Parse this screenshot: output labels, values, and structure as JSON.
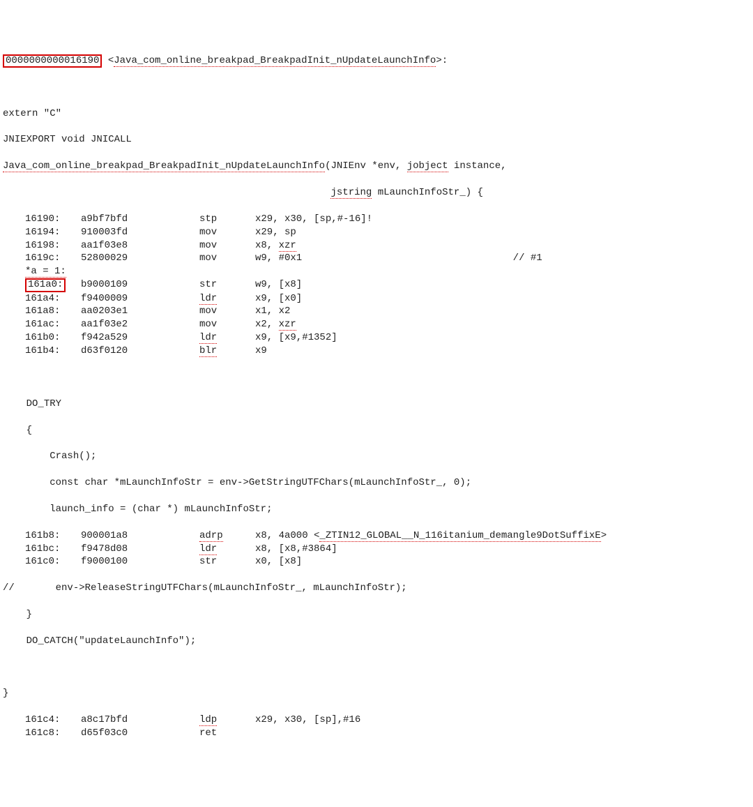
{
  "header": {
    "offset": "0000000000016190",
    "symbol": "Java_com_online_breakpad_BreakpadInit_nUpdateLaunchInfo"
  },
  "decl": {
    "externC": "extern \"C\"",
    "jniexport": "JNIEXPORT void JNICALL",
    "fn": "Java_com_online_breakpad_BreakpadInit_nUpdateLaunchInfo",
    "params1a": "(JNIEnv *env, ",
    "params1b": "jobject",
    "params1c": " instance,",
    "params2a": "jstring",
    "params2b": " mLaunchInfoStr_) {"
  },
  "src": {
    "aeq1": "*a = 1:",
    "do_try": "DO_TRY",
    "lbrace": "{",
    "crash": "    Crash();",
    "assign1": "    const char *mLaunchInfoStr = env->GetStringUTFChars(mLaunchInfoStr_, 0);",
    "assign2": "    launch_info = (char *) mLaunchInfoStr;",
    "release_pre": "//       env->ReleaseStringUTFChars(mLaunchInfoStr_, mLaunchInfoStr);",
    "rbrace": "}",
    "do_catch": "DO_CATCH(\"updateLaunchInfo\");",
    "fn_rbrace": "}"
  },
  "asm": [
    {
      "addr": "16190:",
      "op": "a9bf7bfd",
      "m": "stp",
      "args": "x29, x30, [sp,#-16]!"
    },
    {
      "addr": "16194:",
      "op": "910003fd",
      "m": "mov",
      "args": "x29, sp"
    },
    {
      "addr": "16198:",
      "op": "aa1f03e8",
      "m": "mov",
      "args_pre": "x8, ",
      "args_u": "xzr"
    },
    {
      "addr": "1619c:",
      "op": "52800029",
      "m": "mov",
      "args": "w9, #0x1",
      "cmt": "// #1"
    },
    {
      "addr": "161a0:",
      "op": "b9000109",
      "m": "str",
      "args": "w9, [x8]",
      "boxed": true
    },
    {
      "addr": "161a4:",
      "op": "f9400009",
      "m": "ldr",
      "args": "x9, [x0]",
      "mu": true
    },
    {
      "addr": "161a8:",
      "op": "aa0203e1",
      "m": "mov",
      "args": "x1, x2"
    },
    {
      "addr": "161ac:",
      "op": "aa1f03e2",
      "m": "mov",
      "args_pre": "x2, ",
      "args_u": "xzr"
    },
    {
      "addr": "161b0:",
      "op": "f942a529",
      "m": "ldr",
      "args": "x9, [x9,#1352]",
      "mu": true
    },
    {
      "addr": "161b4:",
      "op": "d63f0120",
      "m": "blr",
      "args": "x9",
      "mu": true
    }
  ],
  "asm2": [
    {
      "addr": "161b8:",
      "op": "900001a8",
      "m": "adrp",
      "args_pre": "x8, 4a000 <",
      "args_u": "_ZTIN12_GLOBAL__N_116itanium_demangle9DotSuffixE",
      "args_post": ">",
      "mu": true
    },
    {
      "addr": "161bc:",
      "op": "f9478d08",
      "m": "ldr",
      "args": "x8, [x8,#3864]",
      "mu": true
    },
    {
      "addr": "161c0:",
      "op": "f9000100",
      "m": "str",
      "args": "x0, [x8]"
    }
  ],
  "asm3": [
    {
      "addr": "161c4:",
      "op": "a8c17bfd",
      "m": "ldp",
      "args": "x29, x30, [sp],#16",
      "mu": true
    },
    {
      "addr": "161c8:",
      "op": "d65f03c0",
      "m": "ret"
    }
  ]
}
